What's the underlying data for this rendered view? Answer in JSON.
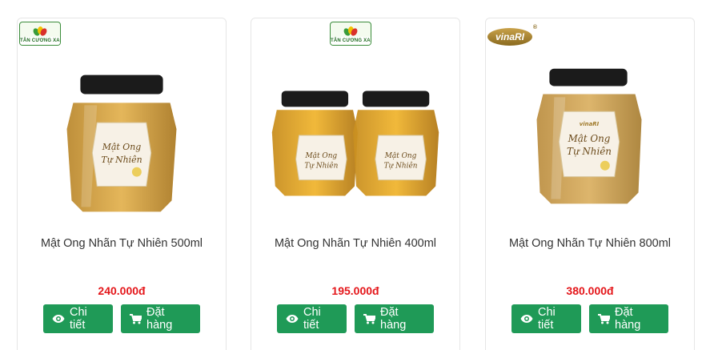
{
  "products": [
    {
      "brand": "TÂN CƯƠNG XANH",
      "label_lines": [
        "Mật Ong",
        "Tự Nhiên"
      ],
      "name": "Mật Ong Nhãn Tự Nhiên 500ml",
      "price": "240.000đ",
      "detail_label": "Chi tiết",
      "order_label": "Đặt hàng"
    },
    {
      "brand": "TÂN CƯƠNG XANH",
      "label_lines": [
        "Mật Ong",
        "Tự Nhiên"
      ],
      "name": "Mật Ong Nhãn Tự Nhiên 400ml",
      "price": "195.000đ",
      "detail_label": "Chi tiết",
      "order_label": "Đặt hàng"
    },
    {
      "brand": "vinaRI",
      "brand_mark": "®",
      "label_lines": [
        "Mật Ong",
        "Tự Nhiên"
      ],
      "name": "Mật Ong Nhãn Tự Nhiên 800ml",
      "price": "380.000đ",
      "detail_label": "Chi tiết",
      "order_label": "Đặt hàng"
    }
  ],
  "colors": {
    "button": "#1f9a57",
    "price": "#e4161a",
    "honey": "#d7a23a",
    "lid": "#1b1b1b"
  },
  "icons": {
    "detail": "eye-icon",
    "order": "cart-icon"
  }
}
